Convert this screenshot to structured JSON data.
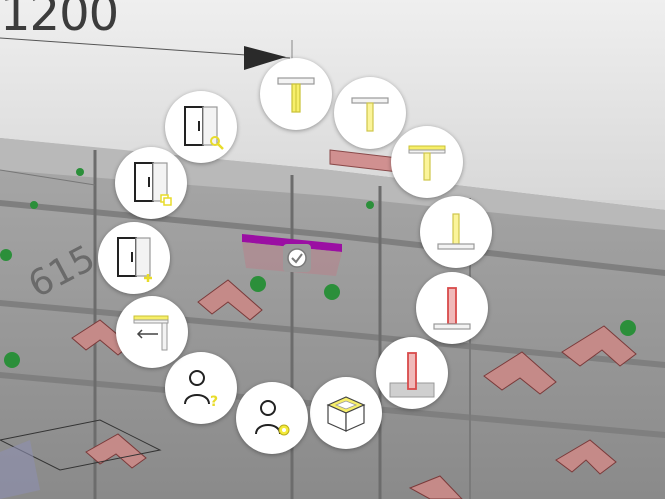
{
  "viewport": {
    "dimension_top": "1200",
    "dimension_side": "615"
  },
  "colors": {
    "accent_yellow": "#f3ea3a",
    "highlight_purple": "#9b0fa3",
    "part_red": "#d84a4a",
    "marker_green": "#2b8f3a"
  },
  "radial_menu": {
    "items": [
      {
        "id": "top-panel",
        "icon": "top-panel-icon"
      },
      {
        "id": "top-panel-narrow",
        "icon": "top-panel-narrow-icon"
      },
      {
        "id": "top-panel-rail",
        "icon": "top-panel-rail-icon"
      },
      {
        "id": "bottom-panel",
        "icon": "bottom-panel-icon"
      },
      {
        "id": "side-panel-red",
        "icon": "side-panel-red-icon"
      },
      {
        "id": "side-panel-base",
        "icon": "side-panel-base-icon"
      },
      {
        "id": "cabinet-box",
        "icon": "cabinet-box-icon"
      },
      {
        "id": "user-settings",
        "icon": "user-settings-icon"
      },
      {
        "id": "user-help",
        "icon": "user-help-icon"
      },
      {
        "id": "insert-top-rail",
        "icon": "insert-top-rail-icon"
      },
      {
        "id": "wardrobe-add",
        "icon": "wardrobe-add-icon"
      },
      {
        "id": "wardrobe-copy",
        "icon": "wardrobe-copy-icon"
      },
      {
        "id": "wardrobe-search",
        "icon": "wardrobe-search-icon"
      }
    ]
  }
}
